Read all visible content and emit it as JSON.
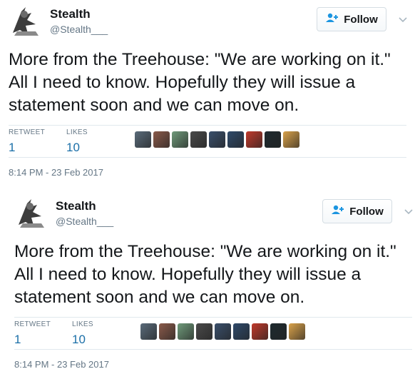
{
  "tweets": [
    {
      "author": {
        "name": "Stealth",
        "handle": "@Stealth___"
      },
      "follow_label": "Follow",
      "text": "More from the Treehouse: \"We are working on it.\" All I need to know. Hopefully they will issue a statement soon and we can move on.",
      "stats": {
        "retweet_label": "RETWEET",
        "retweet_count": "1",
        "likes_label": "LIKES",
        "likes_count": "10"
      },
      "timestamp": "8:14 PM - 23 Feb 2017"
    },
    {
      "author": {
        "name": "Stealth",
        "handle": "@Stealth___"
      },
      "follow_label": "Follow",
      "text": "More from the Treehouse: \"We are working on it.\" All I need to know. Hopefully they will issue a statement soon and we can move on.",
      "stats": {
        "retweet_label": "RETWEET",
        "retweet_count": "1",
        "likes_label": "LIKES",
        "likes_count": "10"
      },
      "timestamp": "8:14 PM - 23 Feb 2017"
    }
  ],
  "colors": {
    "link": "#1b6fa8",
    "muted": "#657786",
    "border": "#e1e8ed"
  },
  "liker_avatar_colors": [
    "#5a6b7a",
    "#8a5a4a",
    "#6f9a7a",
    "#4a4a4a",
    "#3a4f6b",
    "#2f4a6a",
    "#c0392b",
    "#1e2a2f",
    "#d9a24a"
  ]
}
